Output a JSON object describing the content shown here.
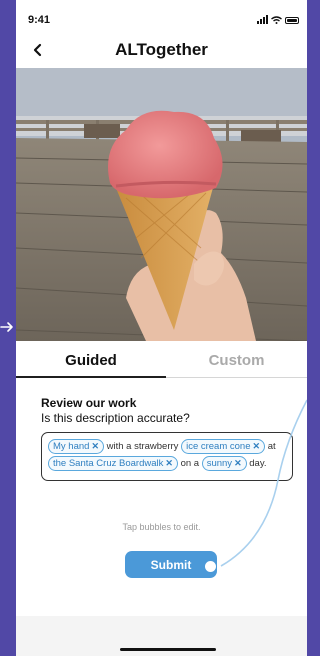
{
  "status": {
    "time": "9:41"
  },
  "nav": {
    "title": "ALTogether",
    "back_icon": "chevron-left-icon"
  },
  "tabs": [
    {
      "label": "Guided",
      "active": true
    },
    {
      "label": "Custom",
      "active": false
    }
  ],
  "review": {
    "heading": "Review our work",
    "question": "Is this description accurate?"
  },
  "description": {
    "pills": [
      "My hand",
      "ice cream cone",
      "the Santa Cruz Boardwalk",
      "sunny"
    ],
    "connectors": [
      "with a strawberry",
      "at",
      "on a",
      "day."
    ]
  },
  "hint": "Tap bubbles to edit.",
  "submit_label": "Submit",
  "colors": {
    "accent": "#4b99d8",
    "frame": "#5148a6"
  }
}
